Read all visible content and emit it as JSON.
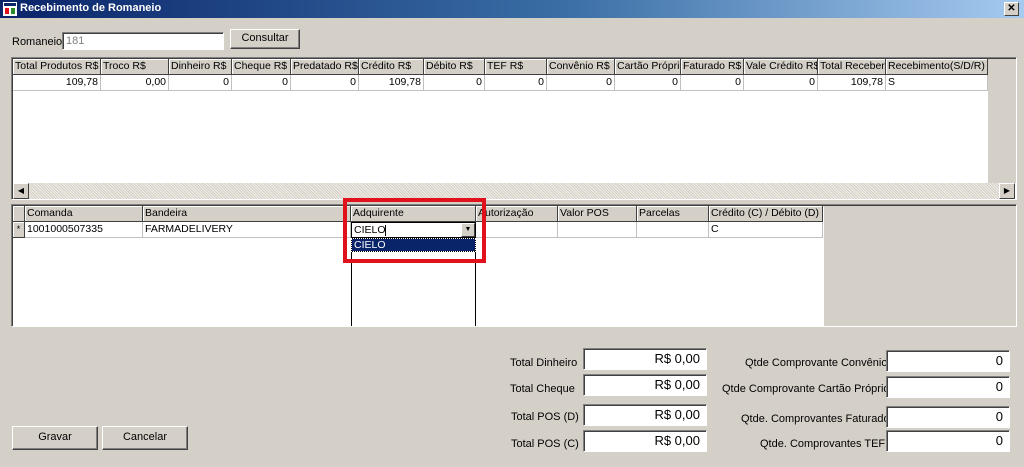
{
  "window": {
    "title": "Recebimento de Romaneio",
    "close": "✕"
  },
  "romaneio": {
    "label": "Romaneio",
    "value": "181",
    "consult_button": "Consultar"
  },
  "top_grid": {
    "headers": [
      "Total Produtos R$",
      "Troco R$",
      "Dinheiro R$",
      "Cheque R$",
      "Predatado R$",
      "Crédito R$",
      "Débito R$",
      "TEF R$",
      "Convênio R$",
      "Cartão Próprio",
      "Faturado R$",
      "Vale Crédito R$",
      "Total Receber",
      "Recebimento(S/D/R)"
    ],
    "row": [
      "109,78",
      "0,00",
      "0",
      "0",
      "0",
      "109,78",
      "0",
      "0",
      "0",
      "0",
      "0",
      "0",
      "109,78",
      "S"
    ]
  },
  "scroll": {
    "left_arrow": "◀",
    "right_arrow": "▶"
  },
  "bottom_grid": {
    "row_marker": "*",
    "headers": [
      "Comanda",
      "Bandeira",
      "Adquirente",
      "Autorização",
      "Valor POS",
      "Parcelas",
      "Crédito (C) / Débito (D)"
    ],
    "row": {
      "comanda": "1001000507335",
      "bandeira": "FARMADELIVERY",
      "adquirente": "CIELO",
      "autorizacao": "",
      "valor_pos": "",
      "parcelas": "",
      "credito_debito": "C"
    },
    "dropdown": {
      "options": [
        "CIELO"
      ],
      "selected": "CIELO"
    }
  },
  "totals_left": [
    {
      "label": "Total Dinheiro",
      "value": "R$ 0,00"
    },
    {
      "label": "Total Cheque",
      "value": "R$ 0,00"
    },
    {
      "label": "Total POS (D)",
      "value": "R$ 0,00"
    },
    {
      "label": "Total POS (C)",
      "value": "R$ 0,00"
    }
  ],
  "totals_right": [
    {
      "label": "Qtde Comprovante Convênio",
      "value": "0"
    },
    {
      "label": "Qtde Comprovante Cartão Próprio",
      "value": "0"
    },
    {
      "label": "Qtde. Comprovantes Faturado",
      "value": "0"
    },
    {
      "label": "Qtde. Comprovantes TEF",
      "value": "0"
    }
  ],
  "actions": {
    "save": "Gravar",
    "cancel": "Cancelar"
  },
  "colors": {
    "highlight": "#e1111c",
    "selection": "#0a246a",
    "titlebar": "#0a246a"
  }
}
